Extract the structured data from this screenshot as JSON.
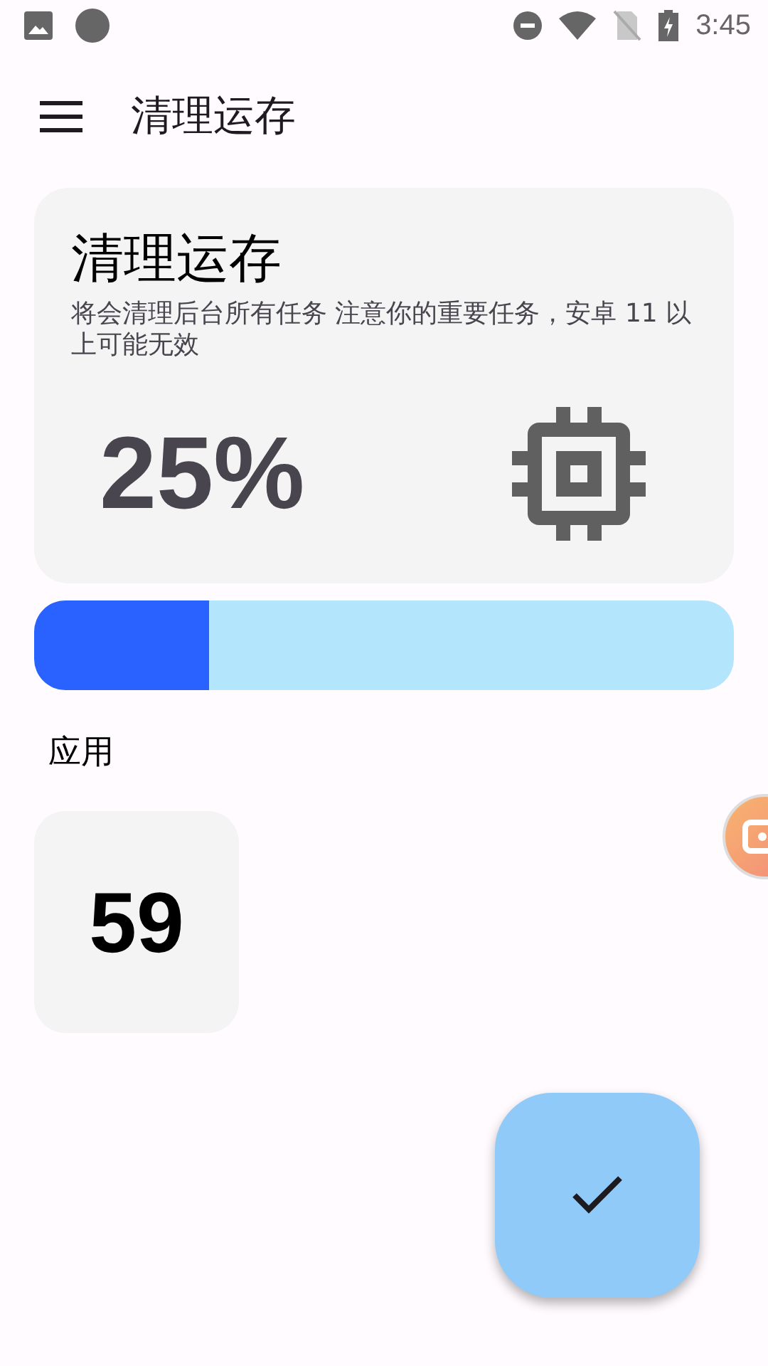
{
  "status_bar": {
    "time": "3:45"
  },
  "app_bar": {
    "title": "清理运存"
  },
  "memory_card": {
    "title": "清理运存",
    "description": "将会清理后台所有任务 注意你的重要任务，安卓 11 以上可能无效",
    "percent": "25%"
  },
  "memory_bar": {
    "level": 0.25
  },
  "apps_section": {
    "label": "应用",
    "count": "59"
  }
}
